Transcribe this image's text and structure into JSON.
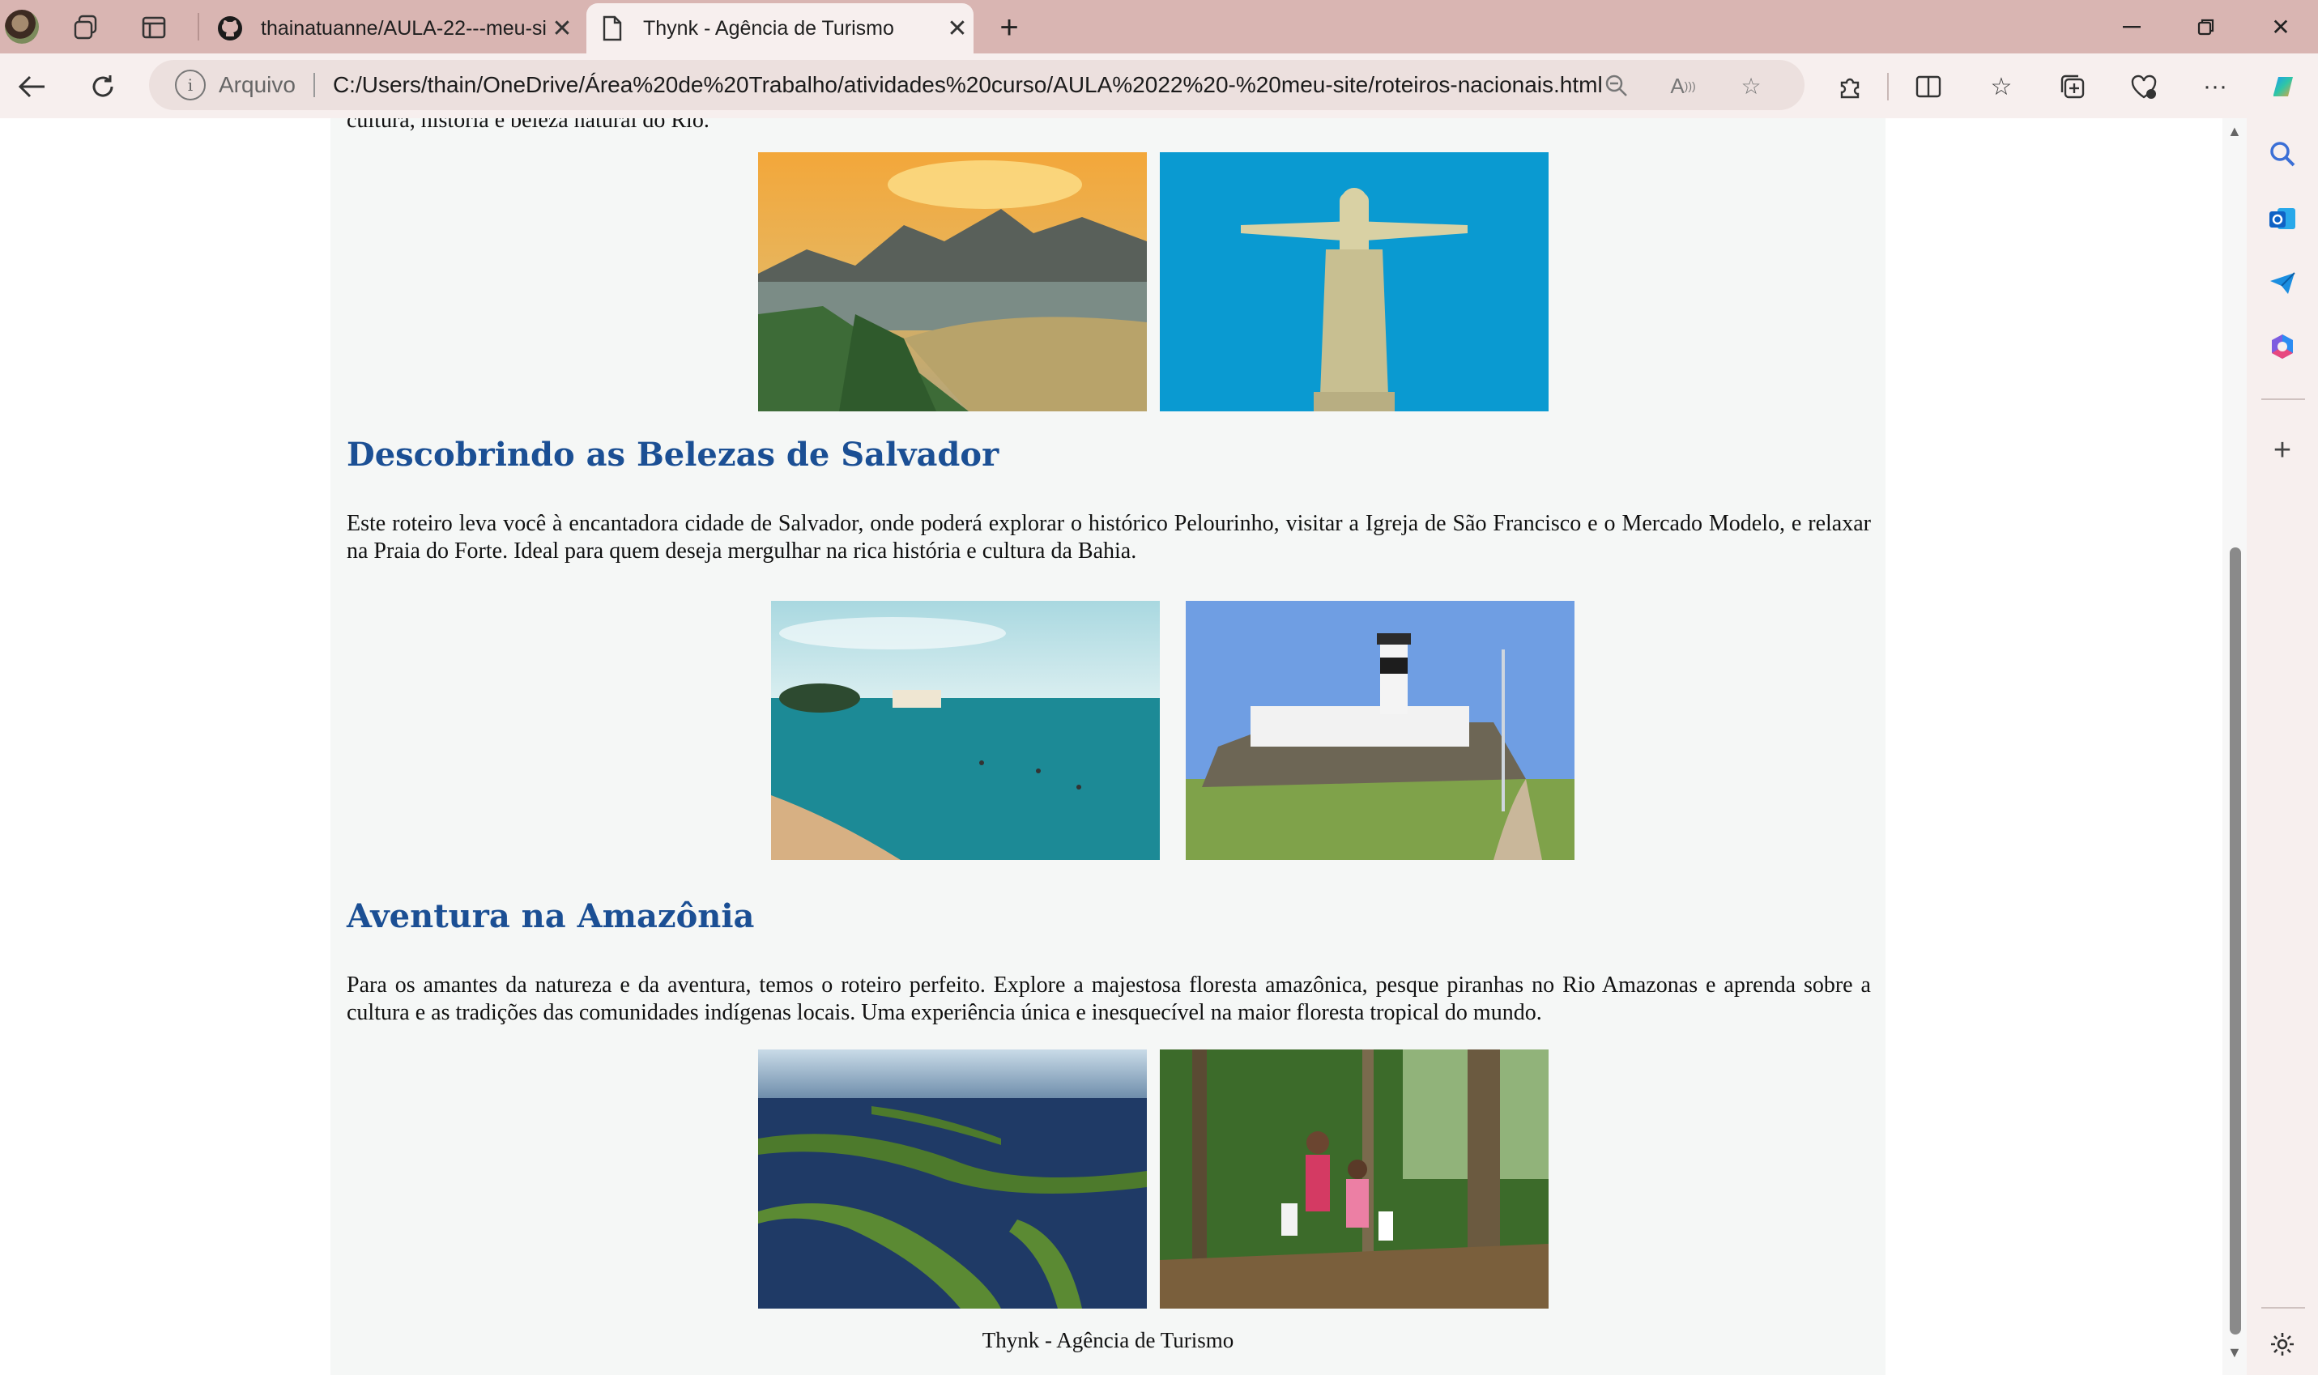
{
  "browser": {
    "tabs": [
      {
        "title": "thainatuanne/AULA-22---meu-si",
        "active": false,
        "favicon": "github-icon"
      },
      {
        "title": "Thynk - Agência de Turismo",
        "active": true,
        "favicon": "page-icon"
      }
    ],
    "address": {
      "label": "Arquivo",
      "url": "C:/Users/thain/OneDrive/Área%20de%20Trabalho/atividades%20curso/AULA%2022%20-%20meu-site/roteiros-nacionais.html"
    }
  },
  "page": {
    "intro_tail": "cultura, história e beleza natural do Rio.",
    "sections": [
      {
        "title": "Descobrindo as Belezas de Salvador",
        "text": "Este roteiro leva você à encantadora cidade de Salvador, onde poderá explorar o histórico Pelourinho, visitar a Igreja de São Francisco e o Mercado Modelo, e relaxar na Praia do Forte. Ideal para quem deseja mergulhar na rica história e cultura da Bahia."
      },
      {
        "title": "Aventura na Amazônia",
        "text": "Para os amantes da natureza e da aventura, temos o roteiro perfeito. Explore a majestosa floresta amazônica, pesque piranhas no Rio Amazonas e aprenda sobre a cultura e as tradições das comunidades indígenas locais. Uma experiência única e inesquecível na maior floresta tropical do mundo."
      }
    ],
    "footer": "Thynk - Agência de Turismo"
  },
  "colors": {
    "heading": "#1b4f94",
    "page_bg": "#f5f7f6",
    "chrome_bg": "#d9b5b2",
    "toolbar_bg": "#f7efee"
  }
}
